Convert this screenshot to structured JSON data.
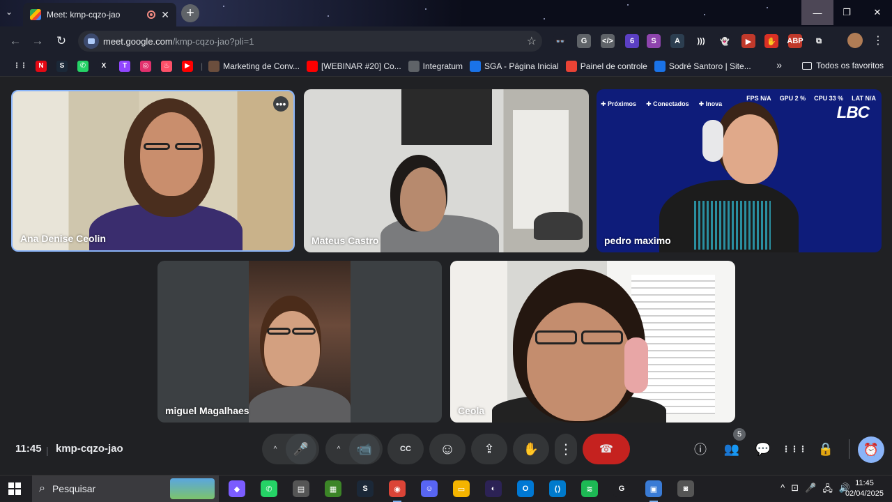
{
  "browser": {
    "tab": {
      "title": "Meet: kmp-cqzo-jao",
      "close_icon": "✕",
      "recording_icon": "recording-icon"
    },
    "new_tab_label": "+",
    "tab_search_label": "⌄",
    "window_controls": {
      "minimize": "—",
      "restore": "❐",
      "close": "✕"
    },
    "nav": {
      "back": "←",
      "forward": "→",
      "reload": "↻"
    },
    "address": {
      "host": "meet.google.com",
      "path": "/kmp-cqzo-jao?pli=1",
      "bookmark_star": "☆"
    },
    "extensions": [
      {
        "name": "incognito-ext-icon",
        "label": "👓",
        "color": "#1c1f2b"
      },
      {
        "name": "g-ext-icon",
        "label": "G",
        "color": "#5f6368"
      },
      {
        "name": "code-ext-icon",
        "label": "</>",
        "color": "#5f6368"
      },
      {
        "name": "shield-ext-icon",
        "label": "6",
        "color": "#5b3fc4"
      },
      {
        "name": "s-ext-icon",
        "label": "S",
        "color": "#8e44ad"
      },
      {
        "name": "a-ext-icon",
        "label": "A",
        "color": "#2c3e50"
      },
      {
        "name": "wave-ext-icon",
        "label": ")))",
        "color": "#1c1f2b"
      },
      {
        "name": "ghost-ext-icon",
        "label": "👻",
        "color": "#1c1f2b"
      },
      {
        "name": "play-ext-icon",
        "label": "▶",
        "color": "#c0392b"
      },
      {
        "name": "hand-ext-icon",
        "label": "✋",
        "color": "#d93025"
      },
      {
        "name": "abp-ext-icon",
        "label": "ABP",
        "color": "#c0392b"
      },
      {
        "name": "puzzle-ext-icon",
        "label": "⧉",
        "color": "#1c1f2b"
      }
    ],
    "bookmarks_bar": {
      "icons": [
        {
          "name": "apps-icon",
          "label": "⋮⋮",
          "color": "#1c1f2b"
        },
        {
          "name": "netflix-icon",
          "label": "N",
          "color": "#e50914"
        },
        {
          "name": "steam-icon",
          "label": "S",
          "color": "#1b2838"
        },
        {
          "name": "whatsapp-icon",
          "label": "✆",
          "color": "#25d366"
        },
        {
          "name": "x-icon",
          "label": "X",
          "color": "#1c1f2b"
        },
        {
          "name": "twitch-icon",
          "label": "T",
          "color": "#9146ff"
        },
        {
          "name": "instagram-icon",
          "label": "◎",
          "color": "#e1306c"
        },
        {
          "name": "tinder-icon",
          "label": "♨",
          "color": "#fd5068"
        },
        {
          "name": "youtube-icon",
          "label": "▶",
          "color": "#ff0000"
        }
      ],
      "items": [
        {
          "label": "Marketing de Conv...",
          "icon": "marketing-icon",
          "color": "#6b4e3d"
        },
        {
          "label": "[WEBINAR #20] Co...",
          "icon": "youtube-icon",
          "color": "#ff0000"
        },
        {
          "label": "Integratum",
          "icon": "globe-icon",
          "color": "#5f6368"
        },
        {
          "label": "SGA - Página Inicial",
          "icon": "sga-icon",
          "color": "#1a73e8"
        },
        {
          "label": "Painel de controle",
          "icon": "dashboard-icon",
          "color": "#ea4335"
        },
        {
          "label": "Sodré Santoro | Site...",
          "icon": "sodre-icon",
          "color": "#1a73e8"
        }
      ],
      "overflow": "»",
      "all_bookmarks": "Todos os favoritos"
    }
  },
  "meet": {
    "participants": [
      {
        "name": "Ana Denise Ceolin"
      },
      {
        "name": "Mateus Castro"
      },
      {
        "name": "pedro maximo"
      },
      {
        "name": "miguel Magalhaes"
      },
      {
        "name": "Ceola"
      }
    ],
    "more_options": "•••",
    "overlay": {
      "menu": [
        "Próximos",
        "Conectados",
        "Inova"
      ],
      "stats": [
        "FPS N/A",
        "GPU 2 %",
        "CPU 33 %",
        "LAT N/A"
      ],
      "logo": "LBC"
    },
    "time": "11:45",
    "separator": "|",
    "meeting_code": "kmp-cqzo-jao",
    "controls": {
      "audio_options": "^",
      "mic": "🎤",
      "video_options": "^",
      "camera": "📹",
      "captions": "CC",
      "emoji": "☺",
      "present": "⇪",
      "raise_hand": "✋",
      "more": "⋮",
      "leave": "☎"
    },
    "side": {
      "info": "ⓘ",
      "people": "👥",
      "people_count": "5",
      "chat": "💬",
      "activities": "⋮⋮⋮",
      "host_controls": "🔒",
      "timer": "⏰"
    }
  },
  "taskbar": {
    "search_placeholder": "Pesquisar",
    "apps": [
      {
        "name": "copilot-icon",
        "label": "◆",
        "color": "#7b5cff"
      },
      {
        "name": "whatsapp-taskbar-icon",
        "label": "✆",
        "color": "#25d366"
      },
      {
        "name": "notes-taskbar-icon",
        "label": "▤",
        "color": "#555"
      },
      {
        "name": "minecraft-taskbar-icon",
        "label": "▦",
        "color": "#3c8527"
      },
      {
        "name": "steam-taskbar-icon",
        "label": "S",
        "color": "#1b2838"
      },
      {
        "name": "chrome-taskbar-icon",
        "label": "◉",
        "color": "#db4437"
      },
      {
        "name": "discord-taskbar-icon",
        "label": "☺",
        "color": "#5865f2"
      },
      {
        "name": "explorer-taskbar-icon",
        "label": "▭",
        "color": "#f4b400"
      },
      {
        "name": "eclipse-taskbar-icon",
        "label": "◐",
        "color": "#2c2255"
      },
      {
        "name": "outlook-taskbar-icon",
        "label": "O",
        "color": "#0078d4"
      },
      {
        "name": "vscode-taskbar-icon",
        "label": "⟨⟩",
        "color": "#007acc"
      },
      {
        "name": "spotify-taskbar-icon",
        "label": "≋",
        "color": "#1db954"
      },
      {
        "name": "g-hub-taskbar-icon",
        "label": "G",
        "color": "#1f1f23"
      },
      {
        "name": "remote-taskbar-icon",
        "label": "▣",
        "color": "#3a7bd5"
      },
      {
        "name": "camera-taskbar-icon",
        "label": "◙",
        "color": "#555"
      }
    ],
    "tray": [
      "^",
      "⊡",
      "🎤",
      "🖧",
      "🔊"
    ],
    "clock_time": "11:45",
    "clock_date": "02/04/2025"
  }
}
